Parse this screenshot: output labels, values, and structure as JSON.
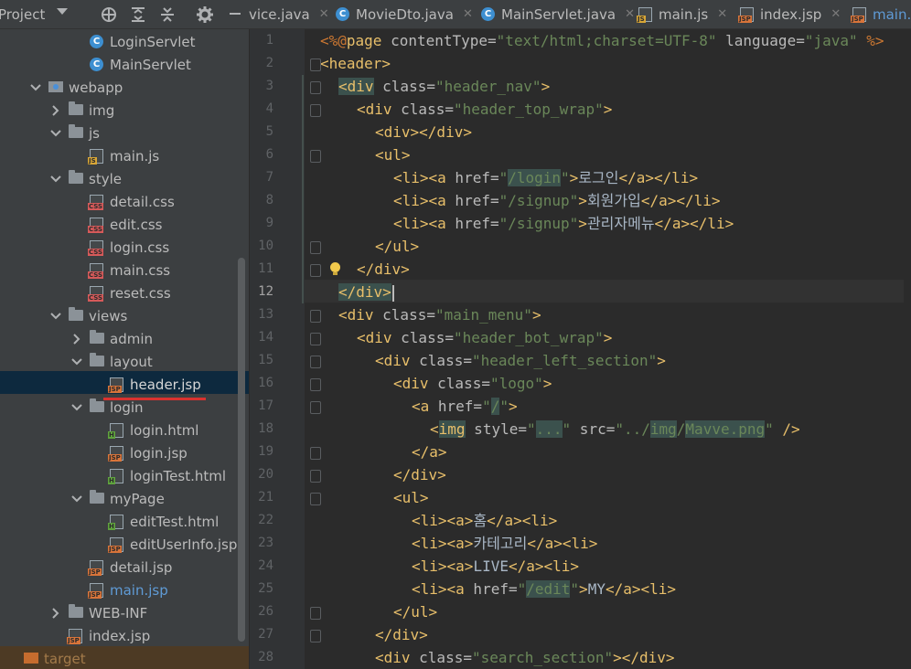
{
  "toolbar": {
    "project_label": "Project",
    "icons": [
      "crosshair-icon",
      "expand-all-icon",
      "collapse-all-icon",
      "settings-icon"
    ]
  },
  "tabs": [
    {
      "label": "vice.java",
      "type": "java",
      "active": false
    },
    {
      "label": "MovieDto.java",
      "type": "class",
      "active": false
    },
    {
      "label": "MainServlet.java",
      "type": "class",
      "active": false
    },
    {
      "label": "main.js",
      "type": "js",
      "active": false
    },
    {
      "label": "index.jsp",
      "type": "jsp",
      "active": false
    },
    {
      "label": "main.j",
      "type": "jsp",
      "active": true
    }
  ],
  "tree": [
    {
      "label": "LoginServlet",
      "icon": "class",
      "depth": 4,
      "chevron": "none"
    },
    {
      "label": "MainServlet",
      "icon": "class",
      "depth": 4,
      "chevron": "none"
    },
    {
      "label": "webapp",
      "icon": "webfolder",
      "depth": 2,
      "chevron": "down"
    },
    {
      "label": "img",
      "icon": "folder",
      "depth": 3,
      "chevron": "right"
    },
    {
      "label": "js",
      "icon": "folder",
      "depth": 3,
      "chevron": "down"
    },
    {
      "label": "main.js",
      "icon": "js",
      "depth": 4,
      "chevron": "none"
    },
    {
      "label": "style",
      "icon": "folder",
      "depth": 3,
      "chevron": "down"
    },
    {
      "label": "detail.css",
      "icon": "css",
      "depth": 4,
      "chevron": "none"
    },
    {
      "label": "edit.css",
      "icon": "css",
      "depth": 4,
      "chevron": "none"
    },
    {
      "label": "login.css",
      "icon": "css",
      "depth": 4,
      "chevron": "none"
    },
    {
      "label": "main.css",
      "icon": "css",
      "depth": 4,
      "chevron": "none"
    },
    {
      "label": "reset.css",
      "icon": "css",
      "depth": 4,
      "chevron": "none"
    },
    {
      "label": "views",
      "icon": "folder",
      "depth": 3,
      "chevron": "down"
    },
    {
      "label": "admin",
      "icon": "folder",
      "depth": 4,
      "chevron": "right"
    },
    {
      "label": "layout",
      "icon": "folder",
      "depth": 4,
      "chevron": "down"
    },
    {
      "label": "header.jsp",
      "icon": "jsp",
      "depth": 5,
      "chevron": "none",
      "selected": true
    },
    {
      "label": "login",
      "icon": "folder",
      "depth": 4,
      "chevron": "down"
    },
    {
      "label": "login.html",
      "icon": "html",
      "depth": 5,
      "chevron": "none"
    },
    {
      "label": "login.jsp",
      "icon": "jsp",
      "depth": 5,
      "chevron": "none"
    },
    {
      "label": "loginTest.html",
      "icon": "html",
      "depth": 5,
      "chevron": "none"
    },
    {
      "label": "myPage",
      "icon": "folder",
      "depth": 4,
      "chevron": "down"
    },
    {
      "label": "editTest.html",
      "icon": "html",
      "depth": 5,
      "chevron": "none"
    },
    {
      "label": "editUserInfo.jsp",
      "icon": "jsp",
      "depth": 5,
      "chevron": "none"
    },
    {
      "label": "detail.jsp",
      "icon": "jsp",
      "depth": 4,
      "chevron": "none"
    },
    {
      "label": "main.jsp",
      "icon": "jsp",
      "depth": 4,
      "chevron": "none",
      "highlight": true
    },
    {
      "label": "WEB-INF",
      "icon": "folder",
      "depth": 3,
      "chevron": "right"
    },
    {
      "label": "index.jsp",
      "icon": "jsp",
      "depth": 3,
      "chevron": "none"
    },
    {
      "label": "target",
      "icon": "target",
      "depth": 0,
      "chevron": "none",
      "muted": true
    }
  ],
  "editor": {
    "current_line": 12,
    "lines": [
      {
        "n": 1,
        "indent": 0,
        "fold": false,
        "parts": [
          [
            "dir",
            "<%@"
          ],
          [
            "tag",
            "page"
          ],
          [
            "attr",
            " contentType="
          ],
          [
            "str",
            "\"text/html;charset=UTF-8\""
          ],
          [
            "attr",
            " language="
          ],
          [
            "str",
            "\"java\""
          ],
          [
            "dir",
            " %>"
          ]
        ]
      },
      {
        "n": 2,
        "indent": 0,
        "fold": true,
        "parts": [
          [
            "tag",
            "<header>"
          ]
        ]
      },
      {
        "n": 3,
        "indent": 1,
        "fold": true,
        "parts": [
          [
            "tagh",
            "<div"
          ],
          [
            "attr",
            " class="
          ],
          [
            "str",
            "\"header_nav\""
          ],
          [
            "tag",
            ">"
          ]
        ]
      },
      {
        "n": 4,
        "indent": 2,
        "fold": true,
        "parts": [
          [
            "tag",
            "<div"
          ],
          [
            "attr",
            " class="
          ],
          [
            "str",
            "\"header_top_wrap\""
          ],
          [
            "tag",
            ">"
          ]
        ]
      },
      {
        "n": 5,
        "indent": 3,
        "fold": false,
        "parts": [
          [
            "tag",
            "<div></div>"
          ]
        ]
      },
      {
        "n": 6,
        "indent": 3,
        "fold": true,
        "parts": [
          [
            "tag",
            "<ul>"
          ]
        ]
      },
      {
        "n": 7,
        "indent": 4,
        "fold": false,
        "parts": [
          [
            "tag",
            "<li><a"
          ],
          [
            "attr",
            " href="
          ],
          [
            "str",
            "\""
          ],
          [
            "strh",
            "/login"
          ],
          [
            "str",
            "\""
          ],
          [
            "tag",
            ">"
          ],
          [
            "txt",
            "로그인"
          ],
          [
            "tag",
            "</a></li>"
          ]
        ]
      },
      {
        "n": 8,
        "indent": 4,
        "fold": false,
        "parts": [
          [
            "tag",
            "<li><a"
          ],
          [
            "attr",
            " href="
          ],
          [
            "str",
            "\"/signup\""
          ],
          [
            "tag",
            ">"
          ],
          [
            "txt",
            "회원가입"
          ],
          [
            "tag",
            "</a></li>"
          ]
        ]
      },
      {
        "n": 9,
        "indent": 4,
        "fold": false,
        "parts": [
          [
            "tag",
            "<li><a"
          ],
          [
            "attr",
            " href="
          ],
          [
            "str",
            "\"/signup\""
          ],
          [
            "tag",
            ">"
          ],
          [
            "txt",
            "관리자메뉴"
          ],
          [
            "tag",
            "</a></li>"
          ]
        ]
      },
      {
        "n": 10,
        "indent": 3,
        "fold": true,
        "parts": [
          [
            "tag",
            "</ul>"
          ]
        ]
      },
      {
        "n": 11,
        "indent": 2,
        "fold": true,
        "parts": [
          [
            "tag",
            "</div>"
          ]
        ]
      },
      {
        "n": 12,
        "indent": 1,
        "fold": false,
        "parts": [
          [
            "tagh",
            "</div>"
          ]
        ]
      },
      {
        "n": 13,
        "indent": 1,
        "fold": true,
        "parts": [
          [
            "tag",
            "<div"
          ],
          [
            "attr",
            " class="
          ],
          [
            "str",
            "\"main_menu\""
          ],
          [
            "tag",
            ">"
          ]
        ]
      },
      {
        "n": 14,
        "indent": 2,
        "fold": true,
        "parts": [
          [
            "tag",
            "<div"
          ],
          [
            "attr",
            " class="
          ],
          [
            "str",
            "\"header_bot_wrap\""
          ],
          [
            "tag",
            ">"
          ]
        ]
      },
      {
        "n": 15,
        "indent": 3,
        "fold": true,
        "parts": [
          [
            "tag",
            "<div"
          ],
          [
            "attr",
            " class="
          ],
          [
            "str",
            "\"header_left_section\""
          ],
          [
            "tag",
            ">"
          ]
        ]
      },
      {
        "n": 16,
        "indent": 4,
        "fold": true,
        "parts": [
          [
            "tag",
            "<div"
          ],
          [
            "attr",
            " class="
          ],
          [
            "str",
            "\"logo\""
          ],
          [
            "tag",
            ">"
          ]
        ]
      },
      {
        "n": 17,
        "indent": 5,
        "fold": true,
        "parts": [
          [
            "tag",
            "<a"
          ],
          [
            "attr",
            " href="
          ],
          [
            "str",
            "\""
          ],
          [
            "strh",
            "/"
          ],
          [
            "str",
            "\""
          ],
          [
            "tag",
            ">"
          ]
        ]
      },
      {
        "n": 18,
        "indent": 6,
        "fold": false,
        "parts": [
          [
            "tag",
            "<"
          ],
          [
            "tagh",
            "img"
          ],
          [
            "attr",
            " style="
          ],
          [
            "str",
            "\""
          ],
          [
            "strh",
            "..."
          ],
          [
            "str",
            "\""
          ],
          [
            "attr",
            " src="
          ],
          [
            "str",
            "\"../"
          ],
          [
            "strh",
            "img"
          ],
          [
            "str",
            "/"
          ],
          [
            "strh",
            "Mavve.png"
          ],
          [
            "str",
            "\""
          ],
          [
            "tag",
            " />"
          ]
        ]
      },
      {
        "n": 19,
        "indent": 5,
        "fold": true,
        "parts": [
          [
            "tag",
            "</a>"
          ]
        ]
      },
      {
        "n": 20,
        "indent": 4,
        "fold": true,
        "parts": [
          [
            "tag",
            "</div>"
          ]
        ]
      },
      {
        "n": 21,
        "indent": 4,
        "fold": true,
        "parts": [
          [
            "tag",
            "<ul>"
          ]
        ]
      },
      {
        "n": 22,
        "indent": 5,
        "fold": false,
        "parts": [
          [
            "tag",
            "<li><a>"
          ],
          [
            "txt",
            "홈"
          ],
          [
            "tag",
            "</a><li>"
          ]
        ]
      },
      {
        "n": 23,
        "indent": 5,
        "fold": false,
        "parts": [
          [
            "tag",
            "<li><a>"
          ],
          [
            "txt",
            "카테고리"
          ],
          [
            "tag",
            "</a><li>"
          ]
        ]
      },
      {
        "n": 24,
        "indent": 5,
        "fold": false,
        "parts": [
          [
            "tag",
            "<li><a>"
          ],
          [
            "txt",
            "LIVE"
          ],
          [
            "tag",
            "</a><li>"
          ]
        ]
      },
      {
        "n": 25,
        "indent": 5,
        "fold": false,
        "parts": [
          [
            "tag",
            "<li><a"
          ],
          [
            "attr",
            " href="
          ],
          [
            "str",
            "\""
          ],
          [
            "strh",
            "/edit"
          ],
          [
            "str",
            "\""
          ],
          [
            "tag",
            ">"
          ],
          [
            "txt",
            "MY"
          ],
          [
            "tag",
            "</a><li>"
          ]
        ]
      },
      {
        "n": 26,
        "indent": 4,
        "fold": true,
        "parts": [
          [
            "tag",
            "</ul>"
          ]
        ]
      },
      {
        "n": 27,
        "indent": 3,
        "fold": true,
        "parts": [
          [
            "tag",
            "</div>"
          ]
        ]
      },
      {
        "n": 28,
        "indent": 3,
        "fold": false,
        "parts": [
          [
            "tag",
            "<div"
          ],
          [
            "attr",
            " class="
          ],
          [
            "str",
            "\"search_section\""
          ],
          [
            "tag",
            "></div>"
          ]
        ]
      }
    ]
  },
  "colors": {
    "accent": "#5f9bd6",
    "selection": "#0d293e",
    "underline": "#d9322f"
  }
}
